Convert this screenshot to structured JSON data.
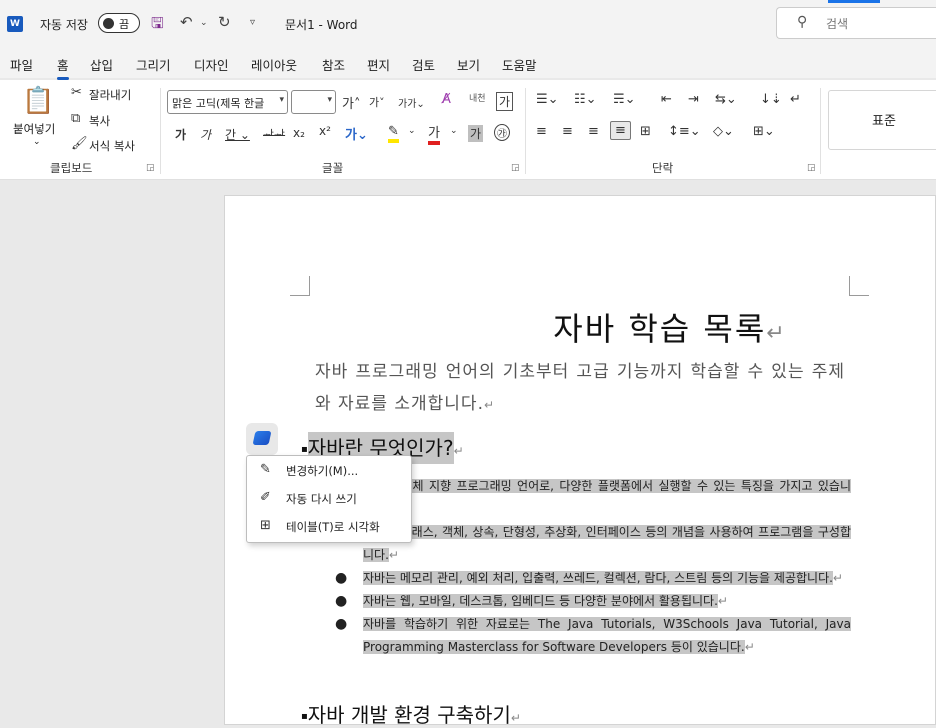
{
  "titlebar": {
    "autosave_label": "자동 저장",
    "toggle_state": "끔",
    "doc_title": "문서1  -  Word",
    "search_placeholder": "검색"
  },
  "tabs": [
    "파일",
    "홈",
    "삽입",
    "그리기",
    "디자인",
    "레이아웃",
    "참조",
    "편지",
    "검토",
    "보기",
    "도움말"
  ],
  "active_tab": "홈",
  "ribbon": {
    "clipboard": {
      "paste": "붙여넣기",
      "cut": "잘라내기",
      "copy": "복사",
      "format_painter": "서식 복사",
      "label": "클립보드"
    },
    "font": {
      "font_name": "맑은 고딕(제목 한글",
      "font_size": "",
      "label": "글꼴"
    },
    "paragraph": {
      "label": "단락"
    },
    "styles": {
      "normal": "표준"
    }
  },
  "document": {
    "title": "자바 학습 목록",
    "subtitle": "자바 프로그래밍 언어의 기초부터 고급 기능까지 학습할 수 있는 주제와 자료를 소개합니다.",
    "section1_heading": "자바란 무엇인가?",
    "bullets": [
      "자바는 객체 지향 프로그래밍 언어로, 다양한 플랫폼에서 실행할 수 있는 특징을 가지고 있습니다.",
      "자바는 클래스, 객체, 상속, 단형성, 추상화, 인터페이스 등의 개념을 사용하여 프로그램을 구성합니다.",
      "자바는 메모리 관리, 예외 처리, 입출력, 쓰레드, 컬렉션, 람다, 스트림 등의 기능을 제공합니다.",
      "자바는 웹, 모바일, 데스크톱, 임베디드 등 다양한 분야에서 활용됩니다.",
      "자바를 학습하기 위한 자료로는 The Java Tutorials, W3Schools Java Tutorial, Java Programming Masterclass for Software Developers 등이 있습니다."
    ],
    "section2_heading": "자바 개발 환경 구축하기",
    "para_mark": "↵"
  },
  "context_menu": {
    "items": [
      "변경하기(M)...",
      "자동 다시 쓰기",
      "테이블(T)로 시각화"
    ]
  }
}
